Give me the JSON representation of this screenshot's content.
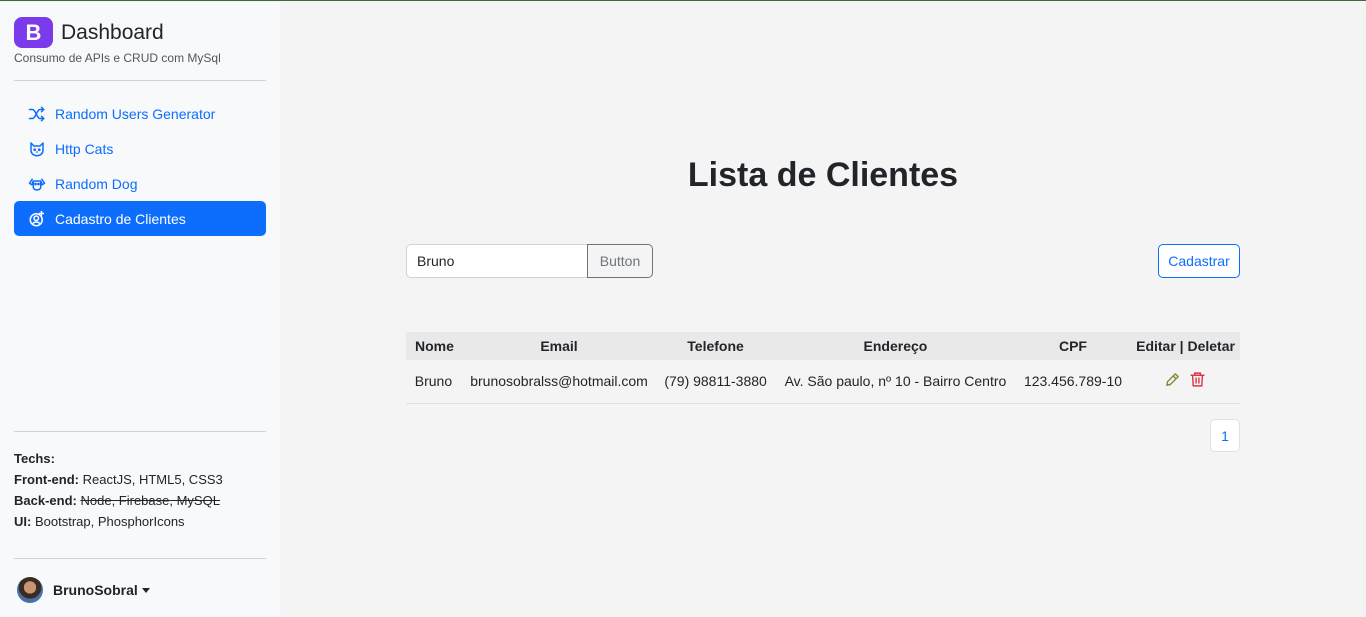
{
  "brand": {
    "logo_letter": "B",
    "title": "Dashboard",
    "subtitle": "Consumo de APIs e CRUD com MySql",
    "color": "#7c3aed"
  },
  "nav": {
    "items": [
      {
        "label": "Random Users Generator",
        "icon": "shuffle-icon",
        "active": false
      },
      {
        "label": "Http Cats",
        "icon": "cat-icon",
        "active": false
      },
      {
        "label": "Random Dog",
        "icon": "dog-icon",
        "active": false
      },
      {
        "label": "Cadastro de Clientes",
        "icon": "user-plus-icon",
        "active": true
      }
    ],
    "active_color": "#0d6efd"
  },
  "techs": {
    "heading": "Techs:",
    "frontend_label": "Front-end:",
    "frontend_value": "ReactJS, HTML5, CSS3",
    "backend_label": "Back-end:",
    "backend_value": "Node, Firebase, MySQL",
    "ui_label": "UI:",
    "ui_value": "Bootstrap, PhosphorIcons"
  },
  "user": {
    "name": "BrunoSobral"
  },
  "main": {
    "title": "Lista de Clientes",
    "search": {
      "value": "Bruno",
      "button_label": "Button"
    },
    "add_button_label": "Cadastrar",
    "table": {
      "headers": [
        "Nome",
        "Email",
        "Telefone",
        "Endereço",
        "CPF",
        "Editar | Deletar"
      ],
      "rows": [
        {
          "nome": "Bruno",
          "email": "brunosobralss@hotmail.com",
          "telefone": "(79) 98811-3880",
          "endereco": "Av. São paulo, nº 10 - Bairro Centro",
          "cpf": "123.456.789-10"
        }
      ]
    },
    "pagination": {
      "current_page": "1"
    }
  }
}
